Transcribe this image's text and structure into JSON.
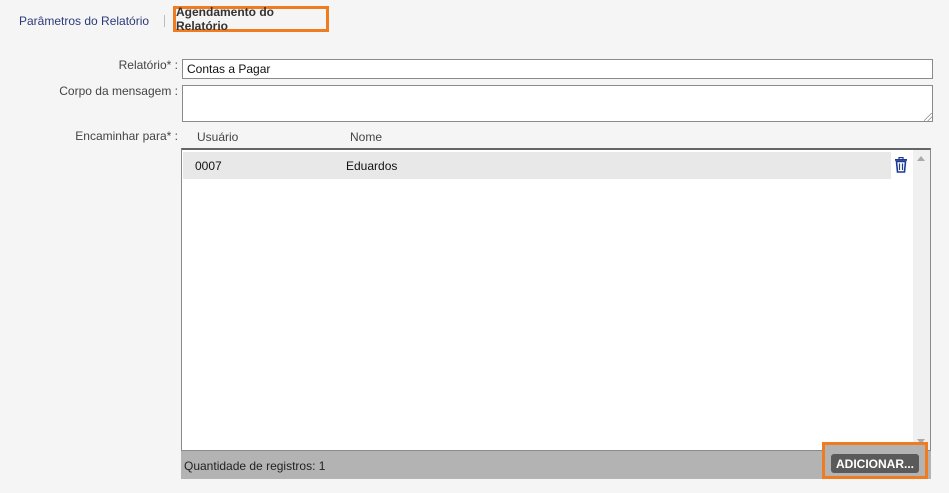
{
  "tabs": {
    "params_label": "Parâmetros do Relatório",
    "schedule_label": "Agendamento do Relatório"
  },
  "form": {
    "report_label": "Relatório* :",
    "report_value": "Contas a Pagar",
    "body_label": "Corpo da mensagem :",
    "body_value": "",
    "forward_label": "Encaminhar para* :"
  },
  "grid": {
    "columns": [
      "Usuário",
      "Nome"
    ],
    "rows": [
      {
        "usuario": "0007",
        "nome": "Eduardos"
      }
    ],
    "record_count_text": "Quantidade de registros: 1",
    "add_button_label": "ADICIONAR..."
  },
  "icons": {
    "delete": "trash-icon",
    "scroll_up": "chevron-up-icon",
    "scroll_down": "chevron-down-icon"
  },
  "colors": {
    "highlight": "#f07c22",
    "tab_link": "#2b3a7a",
    "trash": "#1f3a93"
  }
}
